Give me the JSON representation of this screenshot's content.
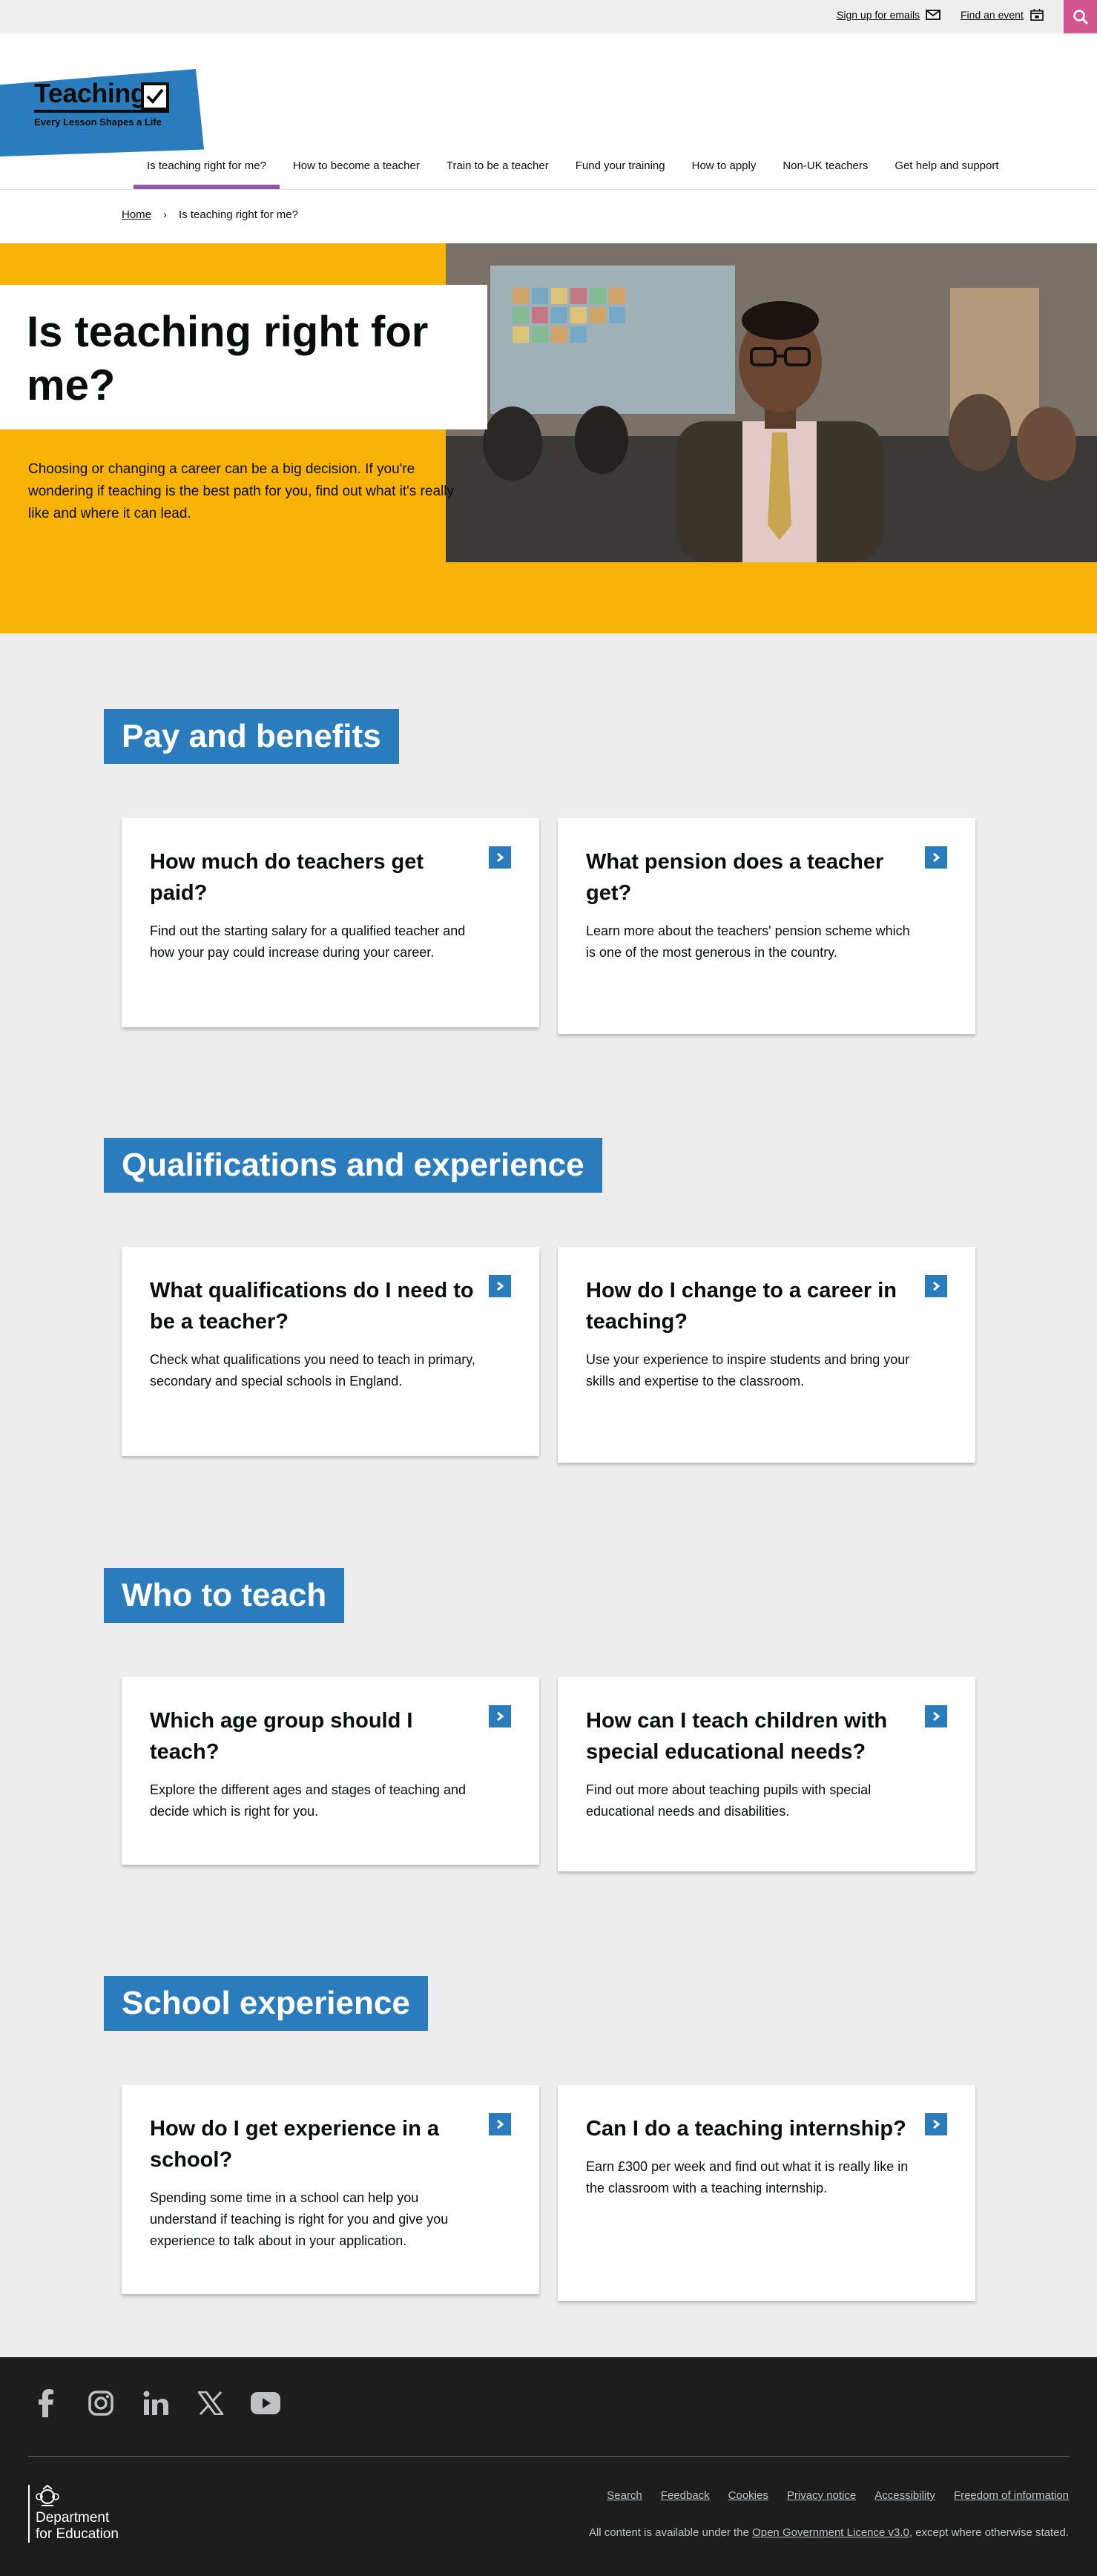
{
  "utility": {
    "signup_label": "Sign up for emails",
    "event_label": "Find an event"
  },
  "brand": {
    "name": "Teaching",
    "tagline": "Every Lesson Shapes a Life",
    "accent_blue": "#2a7cbd",
    "yellow": "#f8b306",
    "pink": "#d4568f",
    "purple": "#8e56a5"
  },
  "nav": {
    "items": [
      {
        "label": "Is teaching right for me?"
      },
      {
        "label": "How to become a teacher"
      },
      {
        "label": "Train to be a teacher"
      },
      {
        "label": "Fund your training"
      },
      {
        "label": "How to apply"
      },
      {
        "label": "Non-UK teachers"
      },
      {
        "label": "Get help and support"
      }
    ],
    "active_index": 0
  },
  "breadcrumb": {
    "home": "Home",
    "separator": "›",
    "current": "Is teaching right for me?"
  },
  "hero": {
    "title": "Is teaching right for me?",
    "intro": "Choosing or changing a career can be a big decision. If you're wondering if teaching is the best path for you, find out what it's really like and where it can lead."
  },
  "sections": [
    {
      "heading": "Pay and benefits",
      "cards": [
        {
          "title": "How much do teachers get paid?",
          "text": "Find out the starting salary for a qualified teacher and how your pay could increase during your career."
        },
        {
          "title": "What pension does a teacher get?",
          "text": "Learn more about the teachers' pension scheme which is one of the most generous in the country."
        }
      ]
    },
    {
      "heading": "Qualifications and experience",
      "cards": [
        {
          "title": "What qualifications do I need to be a teacher?",
          "text": "Check what qualifications you need to teach in primary, secondary and special schools in England."
        },
        {
          "title": "How do I change to a career in teaching?",
          "text": "Use your experience to inspire students and bring your skills and expertise to the classroom."
        }
      ]
    },
    {
      "heading": "Who to teach",
      "cards": [
        {
          "title": "Which age group should I teach?",
          "text": "Explore the different ages and stages of teaching and decide which is right for you."
        },
        {
          "title": "How can I teach children with special educational needs?",
          "text": "Find out more about teaching pupils with special educational needs and disabilities."
        }
      ]
    },
    {
      "heading": "School experience",
      "cards": [
        {
          "title": "How do I get experience in a school?",
          "text": "Spending some time in a school can help you understand if teaching is right for you and give you experience to talk about in your application."
        },
        {
          "title": "Can I do a teaching internship?",
          "text": "Earn £300 per week and find out what it is really like in the classroom with a teaching internship."
        }
      ]
    }
  ],
  "footer": {
    "social_icons": [
      "facebook-icon",
      "instagram-icon",
      "linkedin-icon",
      "x-icon",
      "youtube-icon"
    ],
    "department_line1": "Department",
    "department_line2": "for Education",
    "links": [
      "Search",
      "Feedback",
      "Cookies",
      "Privacy notice",
      "Accessibility",
      "Freedom of information"
    ],
    "licence_prefix": "All content is available under the ",
    "licence_link": "Open Government Licence v3.0",
    "licence_suffix": ", except where otherwise stated."
  }
}
